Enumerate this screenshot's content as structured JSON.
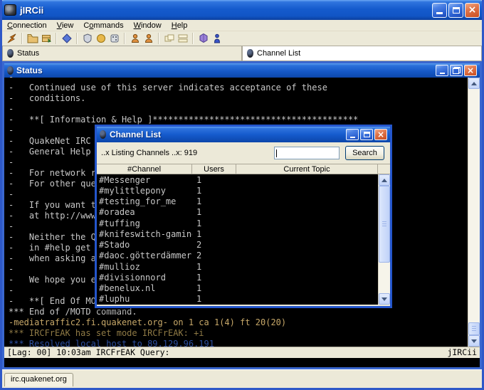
{
  "window": {
    "title": "jIRCii"
  },
  "menu": {
    "items": [
      {
        "pre": "",
        "u": "C",
        "rest": "onnection"
      },
      {
        "pre": "",
        "u": "V",
        "rest": "iew"
      },
      {
        "pre": "C",
        "u": "o",
        "rest": "mmands"
      },
      {
        "pre": "",
        "u": "W",
        "rest": "indow"
      },
      {
        "pre": "",
        "u": "H",
        "rest": "elp"
      }
    ]
  },
  "toolbar": {
    "icons": [
      "connect-icon",
      "folder-open-icon",
      "package-icon",
      "scripts-icon",
      "shield-icon",
      "coin-icon",
      "dice-icon",
      "user-orange-icon",
      "user-orange2-icon",
      "window-tile-icon",
      "window-cascade-icon",
      "gem-icon",
      "person-blue-icon"
    ]
  },
  "tabs": [
    {
      "label": "Status",
      "active": false
    },
    {
      "label": "Channel List",
      "active": true
    }
  ],
  "status_window": {
    "title": "Status",
    "terminal_lines": [
      {
        "text": "-"
      },
      {
        "text": "-   Continued use of this server indicates acceptance of these"
      },
      {
        "text": "-   conditions."
      },
      {
        "text": "-"
      },
      {
        "text": "-   **[ Information & Help ]****************************************"
      },
      {
        "text": "-"
      },
      {
        "text": "-   QuakeNet IRC"
      },
      {
        "text": "-   General Help"
      },
      {
        "text": "-"
      },
      {
        "text": "-   For network r"
      },
      {
        "text": "-   For other que"
      },
      {
        "text": "-"
      },
      {
        "text": "-   If you want t"
      },
      {
        "text": "-   at http://www"
      },
      {
        "text": "-"
      },
      {
        "text": "-   Neither the Q"
      },
      {
        "text": "-   in #help get "
      },
      {
        "text": "-   when asking a"
      },
      {
        "text": "-"
      },
      {
        "text": "-   We hope you e"
      },
      {
        "text": "-"
      },
      {
        "text": "-   **[ End Of MO"
      },
      {
        "text": "*** End of /MOTD command."
      },
      {
        "text": "-mediatraffic2.fi.quakenet.org- on 1 ca 1(4) ft 20(20)",
        "color": "#c7a869"
      },
      {
        "text": "*** IRCFrEAK has set mode IRCFrEAK: +i",
        "color": "#8f7a45"
      },
      {
        "text": "*** Resolved local host to 89.129.96.191",
        "color": "#2d4fa0"
      }
    ],
    "statusbar_left": "[Lag: 00] 10:03am IRCFrEAK Query:",
    "statusbar_right": "jIRCii"
  },
  "dialog": {
    "title": "Channel List",
    "listing_text": "..x Listing Channels ..x: 919",
    "search_value": "",
    "search_button": "Search",
    "columns": [
      "#Channel",
      "Users",
      "Current Topic"
    ],
    "rows": [
      {
        "channel": "#Messenger",
        "users": "1",
        "topic": ""
      },
      {
        "channel": "#mylittlepony",
        "users": "1",
        "topic": ""
      },
      {
        "channel": "#testing_for_me",
        "users": "1",
        "topic": ""
      },
      {
        "channel": "#oradea",
        "users": "1",
        "topic": ""
      },
      {
        "channel": "#tuffing",
        "users": "1",
        "topic": ""
      },
      {
        "channel": "#knifeswitch-gaming",
        "users": "1",
        "topic": ""
      },
      {
        "channel": "#Stado",
        "users": "2",
        "topic": ""
      },
      {
        "channel": "#daoc.götterdämmeru",
        "users": "2",
        "topic": ""
      },
      {
        "channel": "#mullioz",
        "users": "1",
        "topic": ""
      },
      {
        "channel": "#divisionnord",
        "users": "1",
        "topic": ""
      },
      {
        "channel": "#benelux.nl",
        "users": "1",
        "topic": ""
      },
      {
        "channel": "#luphu",
        "users": "1",
        "topic": ""
      }
    ]
  },
  "server_tabs": [
    {
      "label": "irc.quakenet.org"
    }
  ],
  "colors": {
    "titlebar_blue": "#1659c8",
    "xp_beige": "#ece9d8",
    "terminal_text": "#c8c8c8",
    "notice_gold": "#c7a869",
    "mode_gold": "#8f7a45",
    "resolved_blue": "#2d4fa0"
  }
}
